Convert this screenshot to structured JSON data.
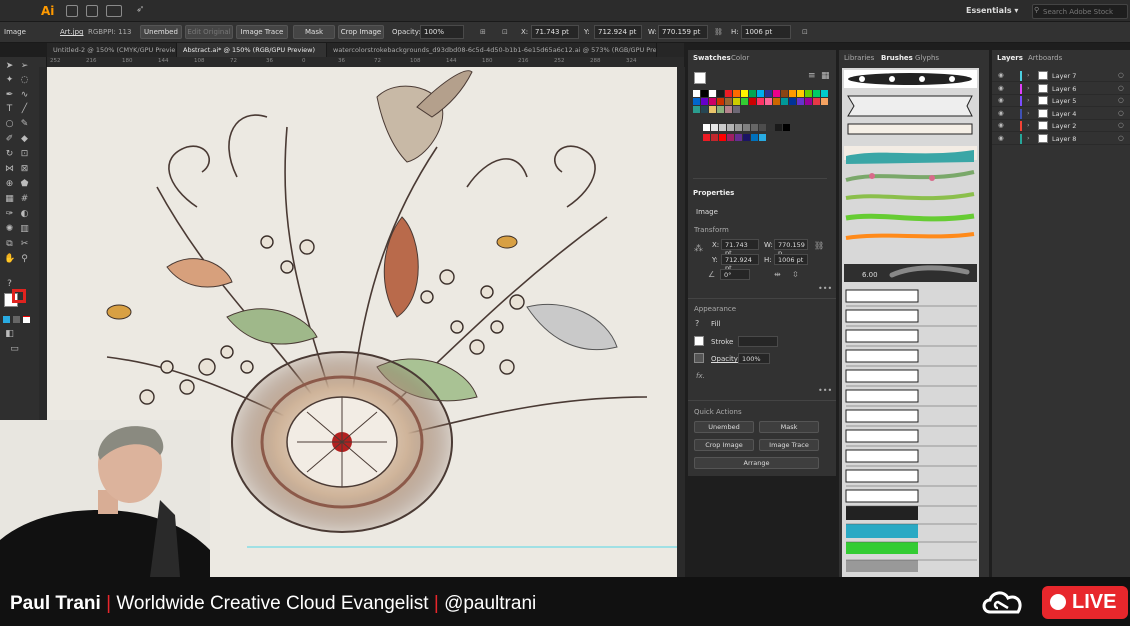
{
  "menubar": {
    "app_logo": "Ai",
    "workspace": "Essentials",
    "search_placeholder": "Search Adobe Stock"
  },
  "control_bar": {
    "selection": "Image",
    "filename": "Art.jpg",
    "color_mode": "RGB",
    "ppi": "PPI: 113",
    "buttons": [
      "Unembed",
      "Edit Original",
      "Image Trace",
      "Mask",
      "Crop Image"
    ],
    "opacity_label": "Opacity:",
    "opacity": "100%",
    "x_label": "X:",
    "x": "71.743 pt",
    "y_label": "Y:",
    "y": "712.924 pt",
    "w_label": "W:",
    "w": "770.159 pt",
    "h_label": "H:",
    "h": "1006 pt"
  },
  "doc_tabs": [
    "Untitled-2 @ 150% (CMYK/GPU Previe...",
    "Abstract.ai* @ 150% (RGB/GPU Preview)",
    "watercolorstrokebackgrounds_d93dbd08-6c5d-4d50-b1b1-6e15d65a6c12.ai @ 573% (RGB/GPU Previe..."
  ],
  "ruler_ticks": [
    "252",
    "216",
    "180",
    "144",
    "108",
    "72",
    "36",
    "0",
    "36",
    "72",
    "108",
    "144",
    "180",
    "216",
    "252",
    "288",
    "324"
  ],
  "swatches_panel": {
    "tabs": [
      "Swatches",
      "Color"
    ],
    "colors": [
      "#ffffff",
      "#000000",
      "#ffffff",
      "#1a1a1a",
      "#ed1c24",
      "#ff6a00",
      "#fff200",
      "#00a651",
      "#00aeef",
      "#2e3192",
      "#ec008c",
      "#8b4513",
      "#ff9900",
      "#ffcc00",
      "#66cc00",
      "#00cc66",
      "#00cccc",
      "#0066cc",
      "#6600cc",
      "#cc0066",
      "#cc3300",
      "#996633",
      "#cccc00",
      "#33cc33",
      "#cc0000",
      "#ff3366",
      "#ff6699",
      "#cc6600",
      "#009999",
      "#003399",
      "#6633cc",
      "#990099",
      "#e63946",
      "#f4a261",
      "#2a9d8f",
      "#264653",
      "#e9c46a",
      "#8ab17d",
      "#b5838d",
      "#6d6875"
    ],
    "grays": [
      "#ffffff",
      "#e6e6e6",
      "#cccccc",
      "#b3b3b3",
      "#999999",
      "#808080",
      "#666666",
      "#4d4d4d",
      "#333333",
      "#1a1a1a",
      "#000000"
    ],
    "extra": [
      "#ed1c24",
      "#c1272d",
      "#ff0000",
      "#9e1f63",
      "#662d91",
      "#1b1464",
      "#0071bc",
      "#29abe2"
    ]
  },
  "properties_panel": {
    "title": "Properties",
    "selection": "Image",
    "transform_title": "Transform",
    "x_label": "X:",
    "x": "71.743 pt",
    "y_label": "Y:",
    "y": "712.924 pt",
    "w_label": "W:",
    "w": "770.159 p",
    "h_label": "H:",
    "h": "1006 pt",
    "angle": "0°",
    "appearance_title": "Appearance",
    "fill_label": "Fill",
    "stroke_label": "Stroke",
    "opacity_label": "Opacity",
    "opacity": "100%",
    "fx_label": "fx.",
    "quick_actions_title": "Quick Actions",
    "qa_buttons": [
      "Unembed",
      "Mask",
      "Crop Image",
      "Image Trace"
    ],
    "arrange_label": "Arrange"
  },
  "brushes_panel": {
    "tabs": [
      "Libraries",
      "Brushes",
      "Glyphs"
    ],
    "size_value": "6.00"
  },
  "layers_panel": {
    "tabs": [
      "Layers",
      "Artboards"
    ],
    "layers": [
      {
        "name": "Layer 7",
        "color": "#4dd0e1"
      },
      {
        "name": "Layer 6",
        "color": "#e040fb"
      },
      {
        "name": "Layer 5",
        "color": "#7c4dff"
      },
      {
        "name": "Layer 4",
        "color": "#3f51b5"
      },
      {
        "name": "Layer 2",
        "color": "#f44336"
      },
      {
        "name": "Layer 8",
        "color": "#26a69a"
      }
    ]
  },
  "lower_third": {
    "presenter": "Paul Trani",
    "title": "Worldwide Creative Cloud Evangelist",
    "handle": "@paultrani",
    "live_label": "LIVE"
  }
}
